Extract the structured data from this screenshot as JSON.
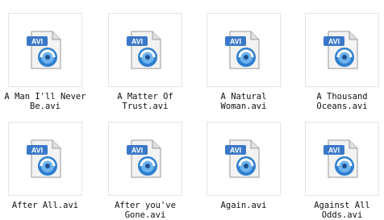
{
  "files": [
    {
      "name": "A Man I'll Never Be.avi",
      "line1": "A Man I'll Never",
      "line2": "Be.avi",
      "badge": "AVI"
    },
    {
      "name": "A Matter Of Trust.avi",
      "line1": "A Matter Of",
      "line2": "Trust.avi",
      "badge": "AVI"
    },
    {
      "name": "A Natural Woman.avi",
      "line1": "A Natural Woman.avi",
      "line2": "",
      "badge": "AVI"
    },
    {
      "name": "A Thousand Oceans.avi",
      "line1": "A Thousand",
      "line2": "Oceans.avi",
      "badge": "AVI"
    },
    {
      "name": "After All.avi",
      "line1": "After All.avi",
      "line2": "",
      "badge": "AVI"
    },
    {
      "name": "After you've Gone.avi",
      "line1": "After you've",
      "line2": "Gone.avi",
      "badge": "AVI"
    },
    {
      "name": "Again.avi",
      "line1": "Again.avi",
      "line2": "",
      "badge": "AVI"
    },
    {
      "name": "Against All Odds.avi",
      "line1": "Against All Odds.avi",
      "line2": "",
      "badge": "AVI"
    }
  ],
  "colors": {
    "badge": "#3a78c9",
    "disc": "#2f7fd0",
    "paper": "#f4f4f4"
  }
}
